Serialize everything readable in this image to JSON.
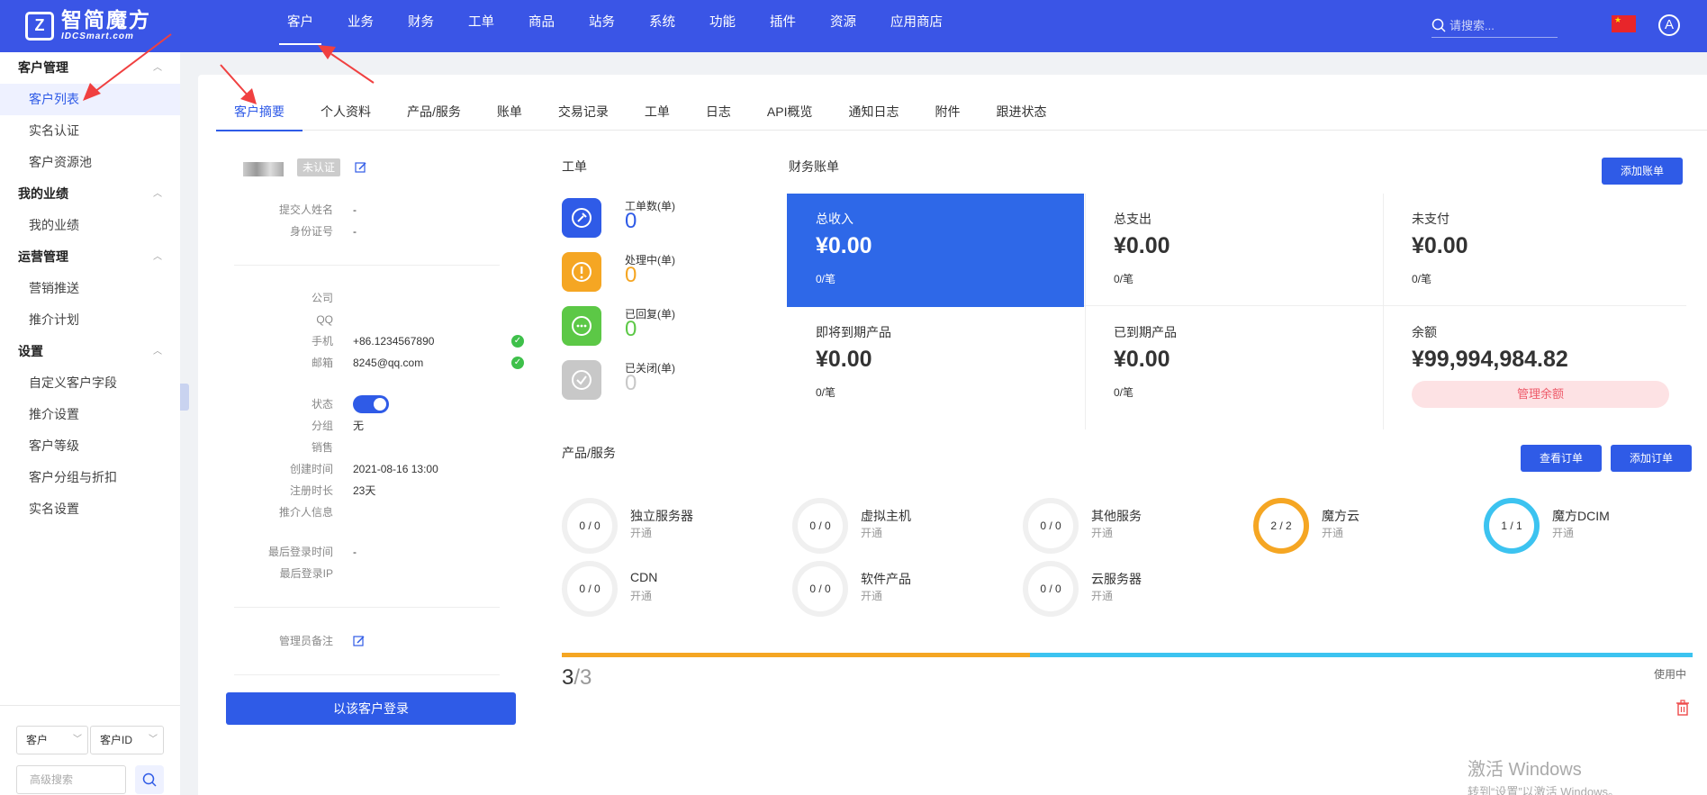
{
  "header": {
    "logo_cn": "智简魔方",
    "logo_en": "IDCSmart.com",
    "nav": [
      "客户",
      "业务",
      "财务",
      "工单",
      "商品",
      "站务",
      "系统",
      "功能",
      "插件",
      "资源",
      "应用商店"
    ],
    "active_nav": 0,
    "search_placeholder": "请搜索...",
    "avatar_letter": "A"
  },
  "sidebar": {
    "groups": [
      {
        "title": "客户管理",
        "items": [
          "客户列表",
          "实名认证",
          "客户资源池"
        ]
      },
      {
        "title": "我的业绩",
        "items": [
          "我的业绩"
        ]
      },
      {
        "title": "运营管理",
        "items": [
          "营销推送",
          "推介计划"
        ]
      },
      {
        "title": "设置",
        "items": [
          "自定义客户字段",
          "推介设置",
          "客户等级",
          "客户分组与折扣",
          "实名设置"
        ]
      }
    ],
    "active_item": "客户列表",
    "select1": "客户",
    "select2": "客户ID",
    "adv_search_placeholder": "高级搜索"
  },
  "tabs": [
    "客户摘要",
    "个人资料",
    "产品/服务",
    "账单",
    "交易记录",
    "工单",
    "日志",
    "API概览",
    "通知日志",
    "附件",
    "跟进状态"
  ],
  "profile": {
    "status_badge": "未认证",
    "submitter_label": "提交人姓名",
    "submitter_value": "-",
    "idno_label": "身份证号",
    "idno_value": "-",
    "company_label": "公司",
    "qq_label": "QQ",
    "phone_label": "手机",
    "phone_value": "+86.1234567890",
    "email_label": "邮箱",
    "email_value": "8245@qq.com",
    "status_label": "状态",
    "group_label": "分组",
    "group_value": "无",
    "sales_label": "销售",
    "created_label": "创建时间",
    "created_value": "2021-08-16 13:00",
    "reg_label": "注册时长",
    "reg_value": "23天",
    "referrer_label": "推介人信息",
    "lastlogin_label": "最后登录时间",
    "lastlogin_value": "-",
    "lastip_label": "最后登录IP",
    "admin_note_label": "管理员备注",
    "login_button": "以该客户登录"
  },
  "tickets": {
    "title": "工单",
    "items": [
      {
        "label": "工单数(单)",
        "value": "0",
        "color": "#2f5be7"
      },
      {
        "label": "处理中(单)",
        "value": "0",
        "color": "#f5a623"
      },
      {
        "label": "已回复(单)",
        "value": "0",
        "color": "#5cc846"
      },
      {
        "label": "已关闭(单)",
        "value": "0",
        "color": "#c8c8c8"
      }
    ]
  },
  "finance": {
    "title": "财务账单",
    "add_button": "添加账单",
    "cells": [
      {
        "title": "总收入",
        "amount": "¥0.00",
        "count": "0/笔"
      },
      {
        "title": "总支出",
        "amount": "¥0.00",
        "count": "0/笔"
      },
      {
        "title": "未支付",
        "amount": "¥0.00",
        "count": "0/笔"
      },
      {
        "title": "即将到期产品",
        "amount": "¥0.00",
        "count": "0/笔"
      },
      {
        "title": "已到期产品",
        "amount": "¥0.00",
        "count": "0/笔"
      },
      {
        "title": "余额",
        "amount": "¥99,994,984.82"
      }
    ],
    "manage_balance": "管理余额"
  },
  "products": {
    "title": "产品/服务",
    "view_orders": "查看订单",
    "add_order": "添加订单",
    "items": [
      {
        "ratio": "0 / 0",
        "name": "独立服务器",
        "status": "开通",
        "ring": "gray"
      },
      {
        "ratio": "0 / 0",
        "name": "虚拟主机",
        "status": "开通",
        "ring": "gray"
      },
      {
        "ratio": "0 / 0",
        "name": "其他服务",
        "status": "开通",
        "ring": "gray"
      },
      {
        "ratio": "2 / 2",
        "name": "魔方云",
        "status": "开通",
        "ring": "orange"
      },
      {
        "ratio": "1 / 1",
        "name": "魔方DCIM",
        "status": "开通",
        "ring": "cyan"
      },
      {
        "ratio": "0 / 0",
        "name": "CDN",
        "status": "开通",
        "ring": "gray"
      },
      {
        "ratio": "0 / 0",
        "name": "软件产品",
        "status": "开通",
        "ring": "gray"
      },
      {
        "ratio": "0 / 0",
        "name": "云服务器",
        "status": "开通",
        "ring": "gray"
      }
    ],
    "usage_current": "3",
    "usage_total": "/3",
    "usage_split": 0.414,
    "usage_label": "使用中"
  },
  "watermark": {
    "line1": "激活 Windows",
    "line2": "转到“设置”以激活 Windows。"
  }
}
